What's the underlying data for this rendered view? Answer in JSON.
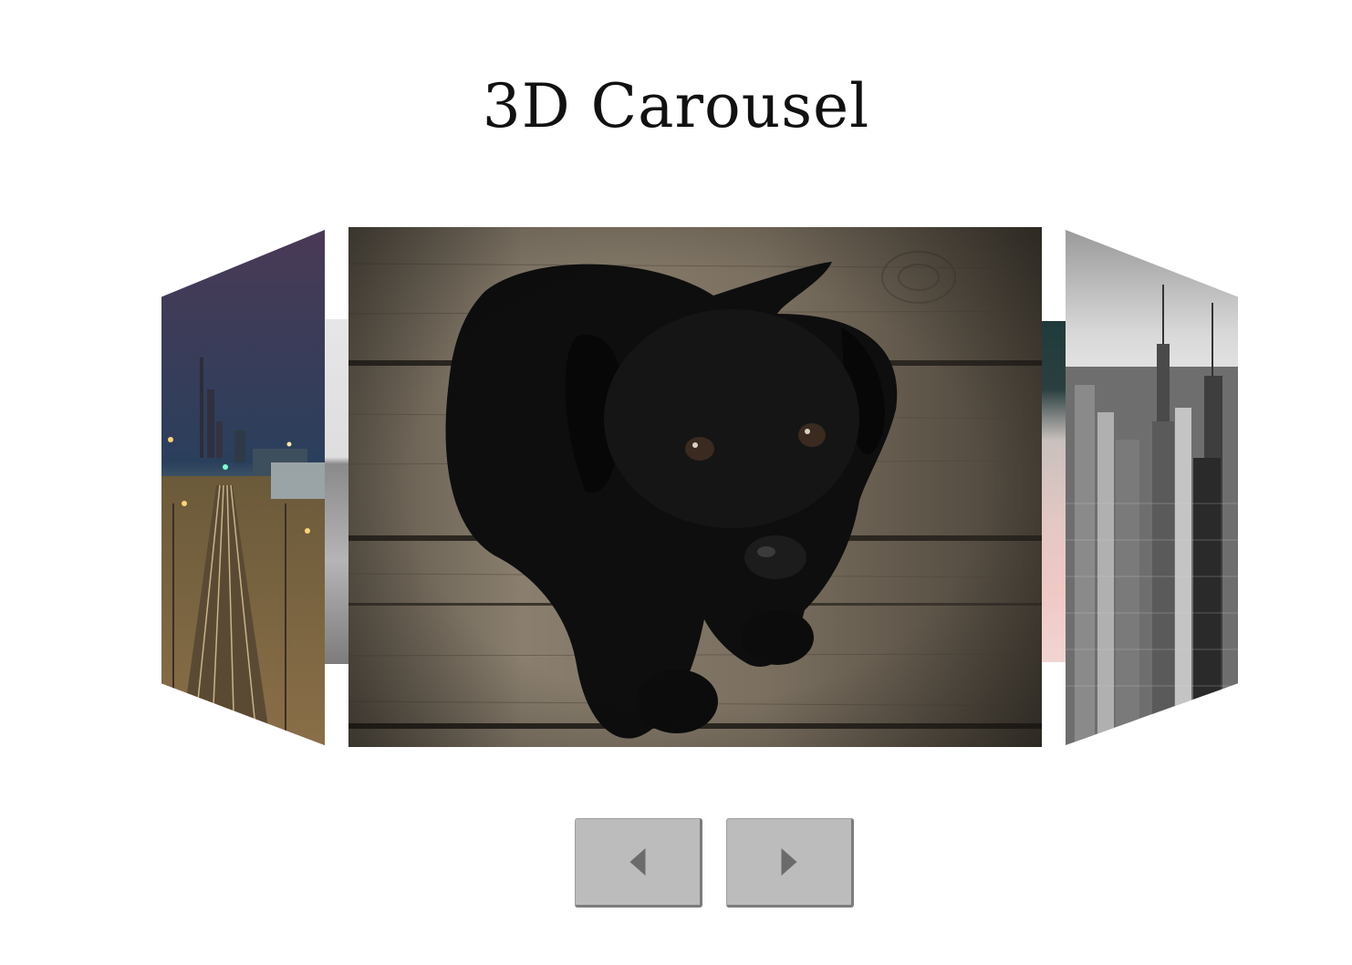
{
  "page": {
    "title": "3D Carousel"
  },
  "carousel": {
    "slides": [
      {
        "position": "left",
        "subject": "railway-tracks-night-city"
      },
      {
        "position": "back-left",
        "subject": "gray-texture"
      },
      {
        "position": "center",
        "subject": "black-puppy-on-wooden-planks"
      },
      {
        "position": "back-right",
        "subject": "dandelion-pink"
      },
      {
        "position": "right",
        "subject": "black-and-white-city-skyline"
      }
    ]
  },
  "controls": {
    "prev_icon": "caret-left-icon",
    "next_icon": "caret-right-icon"
  },
  "colors": {
    "button_bg": "#bcbcbc",
    "button_border": "#7c7c7c",
    "arrow": "#6b6b6b"
  }
}
